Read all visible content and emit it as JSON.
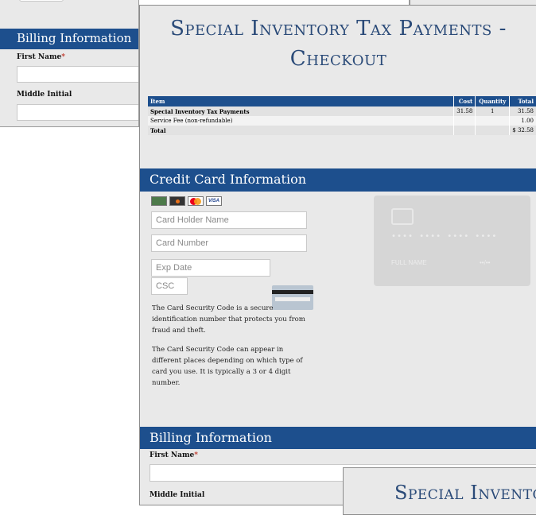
{
  "background_window": {
    "billing_title": "Billing Information",
    "first_name_label": "First Name",
    "required_mark": "*",
    "middle_initial_label": "Middle Initial"
  },
  "checkout": {
    "title_line1": "Special Inventory Tax Payments -",
    "title_line2": "Checkout",
    "table": {
      "headers": [
        "Item",
        "Cost",
        "Quantity",
        "Total"
      ],
      "rows": [
        {
          "item": "Special Inventory Tax Payments",
          "cost": "31.58",
          "quantity": "1",
          "total": "31.58"
        },
        {
          "item": "Service Fee (non-refundable)",
          "cost": "",
          "quantity": "",
          "total": "1.00"
        },
        {
          "item": "Total",
          "cost": "",
          "quantity": "",
          "total": "$ 32.58"
        }
      ]
    },
    "credit_card": {
      "section_title": "Credit Card Information",
      "card_logos": [
        "amex",
        "discover",
        "mastercard",
        "visa"
      ],
      "visa_text": "VISA",
      "holder_placeholder": "Card Holder Name",
      "number_placeholder": "Card Number",
      "exp_placeholder": "Exp Date",
      "csc_placeholder": "CSC",
      "csc_text1": "The Card Security Code is a secure identification number that protects you from fraud and theft.",
      "csc_text2": "The Card Security Code can appear in different places depending on which type of card you use. It is typically a 3 or 4 digit number.",
      "preview_number": "•••• •••• •••• ••••",
      "preview_name": "FULL NAME",
      "preview_expiry": "••/••"
    },
    "billing": {
      "section_title": "Billing Information",
      "first_name_label": "First Name",
      "required_mark": "*",
      "middle_initial_label": "Middle Initial"
    }
  },
  "overlay_window": {
    "title_fragment": "Special Invento"
  },
  "colors": {
    "header_blue": "#1d4f8d",
    "title_blue": "#2a4a78",
    "panel_gray": "#e9e9e9"
  }
}
